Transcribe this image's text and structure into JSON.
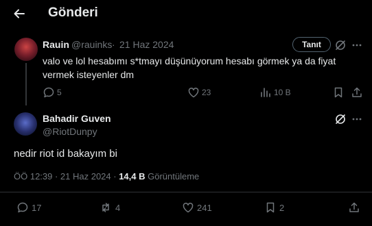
{
  "header": {
    "title": "Gönderi"
  },
  "parent_post": {
    "display_name": "Rauin",
    "handle": "@rauinks",
    "separator": "·",
    "date": "21 Haz 2024",
    "follow_button": "Tanıt",
    "text_line1": "valo ve lol hesabımı s*tmayı düşünüyorum hesabı görmek ya da fiyat",
    "text_line2": "vermek isteyenler dm",
    "actions": {
      "replies": "5",
      "likes": "23",
      "views": "10 B"
    }
  },
  "main_post": {
    "display_name": "Bahadir Guven",
    "handle": "@RiotDunpy",
    "text": "nedir riot id bakayım bi",
    "time": "ÖÖ 12:39 · 21 Haz 2024 · ",
    "views_count": "14,4 B",
    "views_label": " Görüntüleme",
    "actions": {
      "replies": "17",
      "reposts": "4",
      "likes": "241",
      "bookmarks": "2"
    }
  }
}
